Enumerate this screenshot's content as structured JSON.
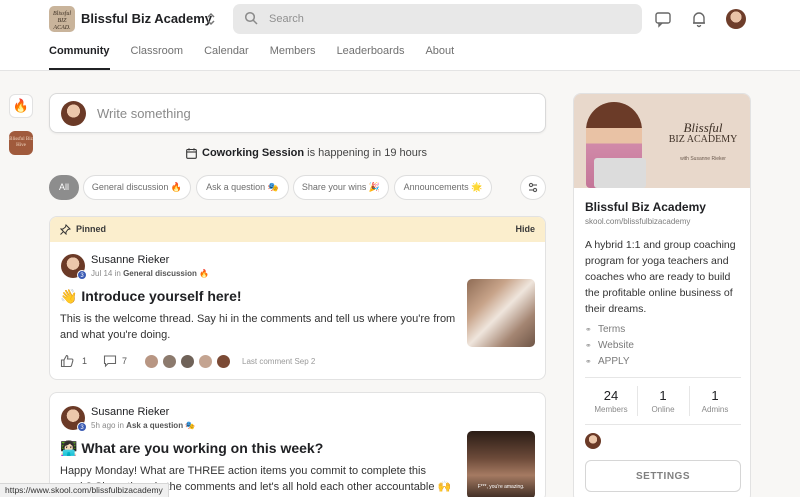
{
  "header": {
    "logo_text": "Blissful Biz Academy",
    "title": "Blissful Biz Academy",
    "search_placeholder": "Search"
  },
  "tabs": [
    "Community",
    "Classroom",
    "Calendar",
    "Members",
    "Leaderboards",
    "About"
  ],
  "active_tab": "Community",
  "rail": {
    "item2_text": "Blissful Biz Hive"
  },
  "composer": {
    "placeholder": "Write something"
  },
  "event": {
    "name": "Coworking Session",
    "suffix": "is happening in 19 hours"
  },
  "filters": [
    "All",
    "General discussion 🔥",
    "Ask a question 🎭",
    "Share your wins 🎉",
    "Announcements 🌟"
  ],
  "active_filter": "All",
  "posts": [
    {
      "pinned_label": "Pinned",
      "hide_label": "Hide",
      "author": "Susanne Rieker",
      "level": "3",
      "date": "Jul 14",
      "in_word": "in",
      "category": "General discussion 🔥",
      "title": "👋 Introduce yourself here!",
      "body": "This is the welcome thread. Say hi in the comments and tell us where you're from and what you're doing.",
      "likes": "1",
      "comments": "7",
      "last_comment": "Last comment Sep 2"
    },
    {
      "author": "Susanne Rieker",
      "level": "3",
      "date": "5h ago",
      "in_word": "in",
      "category": "Ask a question 🎭",
      "title": "👩🏻‍💻 What are you working on this week?",
      "body": "Happy Monday! What are THREE action items you commit to complete this week? Share them in the comments and let's all hold each other accountable 🙌",
      "thumb_caption": "F***, you're amazing."
    }
  ],
  "sidebar": {
    "cover_script": "Blissful",
    "cover_title": "BIZ ACADEMY",
    "cover_sub": "with Susanne Rieker",
    "name": "Blissful Biz Academy",
    "url": "skool.com/blissfulbizacademy",
    "description": "A hybrid 1:1 and group coaching program for yoga teachers and coaches who are ready to build the profitable online business of their dreams.",
    "links": [
      "Terms",
      "Website",
      "APPLY"
    ],
    "stats": [
      {
        "value": "24",
        "label": "Members"
      },
      {
        "value": "1",
        "label": "Online"
      },
      {
        "value": "1",
        "label": "Admins"
      }
    ],
    "settings_label": "SETTINGS"
  },
  "status_url": "https://www.skool.com/blissfulbizacademy"
}
